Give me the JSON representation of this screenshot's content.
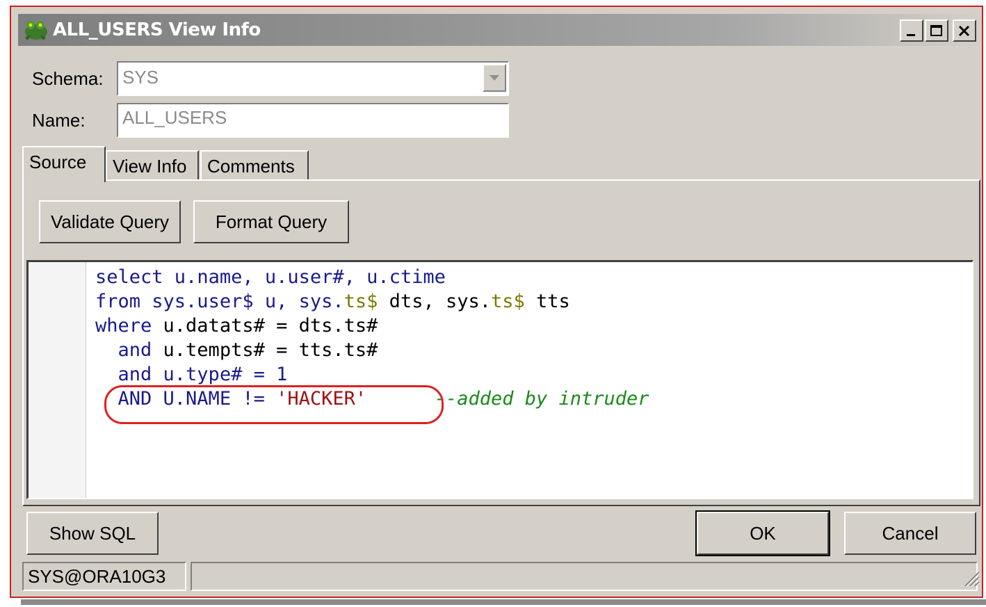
{
  "window": {
    "title": "ALL_USERS View Info"
  },
  "fields": {
    "schema_label": "Schema:",
    "schema_value": "SYS",
    "name_label": "Name:",
    "name_value": "ALL_USERS"
  },
  "tabs": [
    {
      "label": "Source",
      "active": true
    },
    {
      "label": "View Info",
      "active": false
    },
    {
      "label": "Comments",
      "active": false
    }
  ],
  "toolbar": {
    "validate_label": "Validate Query",
    "format_label": "Format Query"
  },
  "source": {
    "line1": {
      "kw": "select",
      "rest": " u.name, u.user#, u.ctime"
    },
    "line2": {
      "kw": "from",
      "a": " sys.user$ u, sys.",
      "t1": "ts$",
      "b": " dts, sys.",
      "t2": "ts$",
      "c": " tts"
    },
    "line3": {
      "kw": "where",
      "rest": " u.datats# = dts.ts#"
    },
    "line4": {
      "kw": "  and",
      "rest": " u.tempts# = tts.ts#"
    },
    "line5": {
      "kw": "  and",
      "rest": " u.type# = 1"
    },
    "line6": {
      "kw": "  AND",
      "rest": " U.NAME != ",
      "str": "'HACKER'",
      "comment": "--added by intruder"
    }
  },
  "footer": {
    "show_sql_label": "Show SQL",
    "ok_label": "OK",
    "cancel_label": "Cancel"
  },
  "status": {
    "connection": "SYS@ORA10G3",
    "message": ""
  },
  "colors": {
    "annotation": "#e02020",
    "keyword": "#1a1a8c",
    "string": "#a01010",
    "comment": "#1a8a1a"
  },
  "icons": [
    "frog-app-icon",
    "minimize-icon",
    "maximize-icon",
    "close-icon",
    "chevron-down-icon",
    "resize-grip-icon"
  ]
}
